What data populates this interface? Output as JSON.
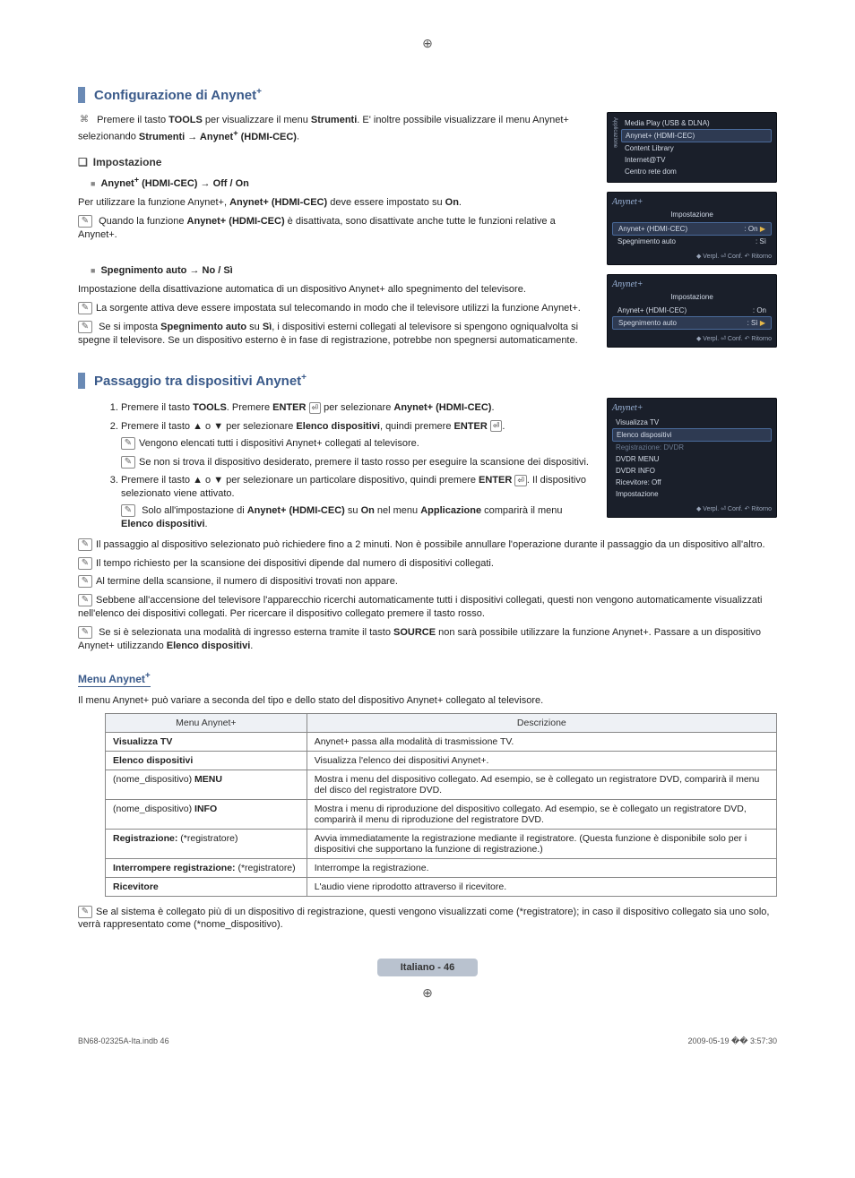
{
  "reg_mark": "⊕",
  "section1": {
    "title_pre": "Configurazione di Anynet",
    "title_sup": "+",
    "tool_note_pre": "Premere il tasto ",
    "tool_note_b1": "TOOLS",
    "tool_note_mid": " per visualizzare il menu ",
    "tool_note_b2": "Strumenti",
    "tool_note_post": ". E' inoltre possibile visualizzare il menu Anynet+ selezionando ",
    "tool_note_b3": "Strumenti → Anynet",
    "tool_note_sup": "+",
    "tool_note_b4": " (HDMI-CEC)",
    "tool_note_end": "."
  },
  "impostazione": {
    "heading": "Impostazione",
    "item1_title_pre": "Anynet",
    "item1_title_sup": "+",
    "item1_title_post": " (HDMI-CEC) → Off / On",
    "item1_line1_pre": "Per utilizzare la funzione Anynet+, ",
    "item1_line1_b": "Anynet+ (HDMI-CEC)",
    "item1_line1_mid": " deve essere impostato su ",
    "item1_line1_b2": "On",
    "item1_line1_end": ".",
    "item1_note_pre": "Quando la funzione ",
    "item1_note_b": "Anynet+ (HDMI-CEC)",
    "item1_note_post": " è disattivata, sono disattivate anche tutte le funzioni relative a Anynet+.",
    "item2_title": "Spegnimento auto → No / Sì",
    "item2_line1": "Impostazione della disattivazione automatica di un dispositivo Anynet+ allo spegnimento del televisore.",
    "item2_note1": "La sorgente attiva deve essere impostata sul telecomando in modo che il televisore utilizzi la funzione Anynet+.",
    "item2_note2_pre": "Se si imposta ",
    "item2_note2_b1": "Spegnimento auto",
    "item2_note2_mid1": " su ",
    "item2_note2_b2": "Sì",
    "item2_note2_post": ", i dispositivi esterni collegati al televisore si spengono ogniqualvolta si spegne il televisore. Se un dispositivo esterno è in fase di registrazione, potrebbe non spegnersi automaticamente."
  },
  "section2": {
    "title_pre": "Passaggio tra dispositivi Anynet",
    "title_sup": "+",
    "step1_pre": "Premere il tasto ",
    "step1_b1": "TOOLS",
    "step1_mid1": ". Premere ",
    "step1_b2": "ENTER",
    "step1_mid2": " per selezionare ",
    "step1_b3": "Anynet+ (HDMI-CEC)",
    "step1_end": ".",
    "step2_pre": "Premere il tasto ▲ o ▼ per selezionare ",
    "step2_b1": "Elenco dispositivi",
    "step2_mid": ", quindi premere ",
    "step2_b2": "ENTER",
    "step2_end": ".",
    "step2_n1": "Vengono elencati tutti i dispositivi Anynet+ collegati al televisore.",
    "step2_n2": "Se non si trova il dispositivo desiderato, premere il tasto rosso per eseguire la scansione dei dispositivi.",
    "step3_pre": "Premere il tasto ▲ o ▼ per selezionare un particolare dispositivo, quindi premere ",
    "step3_b1": "ENTER",
    "step3_post": ". Il dispositivo selezionato viene attivato.",
    "step3_n1_pre": "Solo all'impostazione di ",
    "step3_n1_b1": "Anynet+ (HDMI-CEC)",
    "step3_n1_mid1": " su ",
    "step3_n1_b2": "On",
    "step3_n1_mid2": " nel menu ",
    "step3_n1_b3": "Applicazione",
    "step3_n1_post": " comparirà il menu ",
    "step3_n1_b4": "Elenco dispositivi",
    "step3_n1_end": ".",
    "bottom_n1": "Il passaggio al dispositivo selezionato può richiedere fino a 2 minuti. Non è possibile annullare l'operazione durante il passaggio da un dispositivo all'altro.",
    "bottom_n2": "Il tempo richiesto per la scansione dei dispositivi dipende dal numero di dispositivi collegati.",
    "bottom_n3": "Al termine della scansione, il numero di dispositivi trovati non appare.",
    "bottom_n4": "Sebbene all'accensione del televisore l'apparecchio ricerchi automaticamente tutti i dispositivi collegati, questi non vengono automaticamente visualizzati nell'elenco dei dispositivi collegati. Per ricercare il dispositivo collegato premere il tasto rosso.",
    "bottom_n5_pre": "Se si è selezionata una modalità di ingresso esterna tramite il tasto ",
    "bottom_n5_b": "SOURCE",
    "bottom_n5_mid": " non sarà possibile utilizzare la funzione Anynet+. Passare a un dispositivo Anynet+ utilizzando ",
    "bottom_n5_b2": "Elenco dispositivi",
    "bottom_n5_end": "."
  },
  "menuAnynet": {
    "heading_pre": "Menu Anynet",
    "heading_sup": "+",
    "intro": "Il menu Anynet+ può variare a seconda del tipo e dello stato del dispositivo Anynet+ collegato al televisore.",
    "th1": "Menu Anynet+",
    "th2": "Descrizione",
    "rows": [
      {
        "c1_b": "Visualizza TV",
        "c1_post": "",
        "c2": "Anynet+ passa alla modalità di trasmissione TV."
      },
      {
        "c1_b": "Elenco dispositivi",
        "c1_post": "",
        "c2": "Visualizza l'elenco dei dispositivi Anynet+."
      },
      {
        "c1_pre": "(nome_dispositivo) ",
        "c1_b": "MENU",
        "c2": "Mostra i menu del dispositivo collegato. Ad esempio, se è collegato un registratore DVD, comparirà il menu del disco del registratore DVD."
      },
      {
        "c1_pre": "(nome_dispositivo) ",
        "c1_b": "INFO",
        "c2": "Mostra i menu di riproduzione del dispositivo collegato. Ad esempio, se è collegato un registratore DVD, comparirà il menu di riproduzione del registratore DVD."
      },
      {
        "c1_b": "Registrazione:",
        "c1_post": " (*registratore)",
        "c2": "Avvia immediatamente la registrazione mediante il registratore. (Questa funzione è disponibile solo per i dispositivi che supportano la funzione di registrazione.)"
      },
      {
        "c1_b": "Interrompere registrazione:",
        "c1_post": " (*registratore)",
        "c2": "Interrompe la registrazione."
      },
      {
        "c1_b": "Ricevitore",
        "c1_post": "",
        "c2": "L'audio viene riprodotto attraverso il ricevitore."
      }
    ],
    "final_note": "Se al sistema è collegato più di un dispositivo di registrazione, questi vengono visualizzati come (*registratore); in caso il dispositivo collegato sia uno solo, verrà rappresentato come (*nome_dispositivo)."
  },
  "osd1": {
    "rows": [
      "Media Play (USB & DLNA)",
      "Anynet+ (HDMI-CEC)",
      "Content Library",
      "Internet@TV",
      "Centro rete dom"
    ],
    "side_label": "Applicazione"
  },
  "osd2": {
    "brand": "Anynet+",
    "title": "Impostazione",
    "r1k": "Anynet+ (HDMI-CEC)",
    "r1v": ": On",
    "r2k": "Spegnimento auto",
    "r2v": ": Sì",
    "footer": "◆ Verpl.   ⏎ Conf.   ↶ Ritorno"
  },
  "osd3": {
    "brand": "Anynet+",
    "title": "Impostazione",
    "r1k": "Anynet+ (HDMI-CEC)",
    "r1v": ": On",
    "r2k": "Spegnimento auto",
    "r2v": ": Sì",
    "footer": "◆ Verpl.   ⏎ Conf.   ↶ Ritorno"
  },
  "osd4": {
    "brand": "Anynet+",
    "rows": [
      "Visualizza TV",
      "Elenco dispositivi",
      "Registrazione: DVDR",
      "DVDR MENU",
      "DVDR INFO",
      "Ricevitore: Off",
      "Impostazione"
    ],
    "footer": "◆ Verpl.   ⏎ Conf.   ↶ Ritorno"
  },
  "footer": {
    "badge": "Italiano - 46",
    "left": "BN68-02325A-Ita.indb   46",
    "right": "2009-05-19   �� 3:57:30"
  }
}
